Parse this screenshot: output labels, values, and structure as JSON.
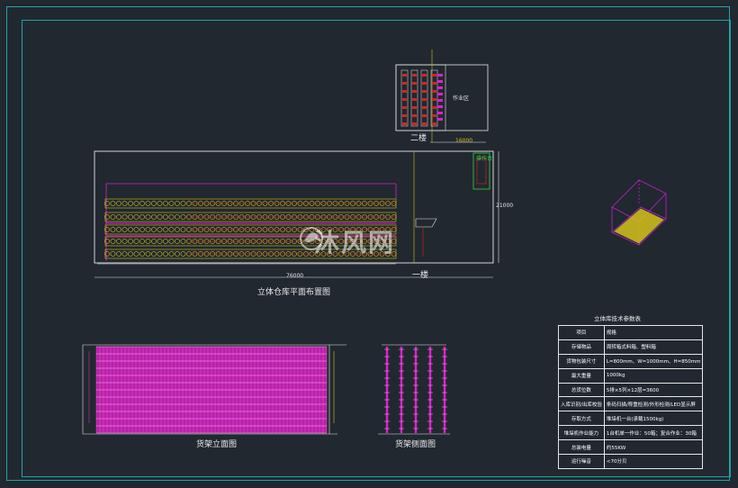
{
  "labels": {
    "floor2": "二楼",
    "floor1": "一楼",
    "plan_title": "立体仓库平面布置图",
    "elevation_title": "货架立面图",
    "side_title": "货架侧面图",
    "small_room": "作业区",
    "dim_plan": "76000",
    "dim_height": "21000",
    "dim_top": "16000",
    "side_box": "操作台"
  },
  "watermark": "沐风网",
  "table": {
    "title": "立体库技术参数表",
    "rows": [
      {
        "k": "项目",
        "v": "规格"
      },
      {
        "k": "存储物品",
        "v": "周转箱式料箱、塑料箱"
      },
      {
        "k": "货物包装尺寸",
        "v": "L=800mm、W=1000mm、H=850mm"
      },
      {
        "k": "最大重量",
        "v": "1000kg"
      },
      {
        "k": "总货位数",
        "v": "5排×5列×12层=3600"
      },
      {
        "k": "入库识别/出库校验",
        "v": "条码扫描/称重检测/外形检测/LED显示屏"
      },
      {
        "k": "存取方式",
        "v": "堆垛机一台(承载1500kg)"
      },
      {
        "k": "堆垛机作业能力",
        "v": "1台机单一作业：50箱；复合作业：30箱"
      },
      {
        "k": "总装电量",
        "v": "约55KW"
      },
      {
        "k": "运行噪音",
        "v": "<70分贝"
      }
    ]
  },
  "colors": {
    "background": "#212830",
    "frame": "#1fa5a5",
    "rack_magenta": "#e01fd0",
    "rack_yellow": "#d4c21a",
    "line_white": "#e6e6e6",
    "accent_red": "#e02020",
    "accent_green": "#3ad13a"
  }
}
